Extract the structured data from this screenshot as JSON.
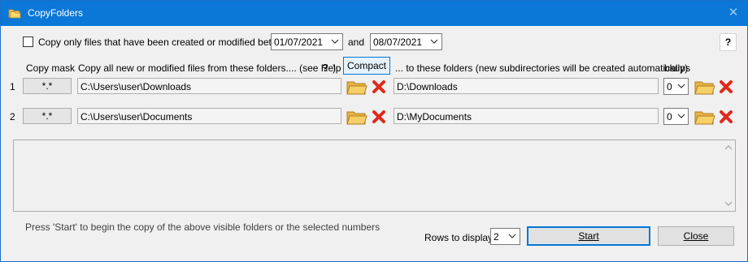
{
  "window": {
    "title": "CopyFolders",
    "close_glyph": "✕",
    "icon": "folder-copy-icon"
  },
  "filter": {
    "checkbox_label": "Copy only files that have been created or modified between",
    "checked": false,
    "date_from": "01/07/2021",
    "and_label": "and",
    "date_to": "08/07/2021"
  },
  "help": {
    "label": "?"
  },
  "headers": {
    "copy_mask": "Copy mask",
    "source": "Copy all new or modified files from these folders.... (see Help in",
    "source_help": "?",
    "source_close": ")",
    "compact_button": "Compact",
    "destination": "... to these folders (new subdirectories will be created automatically)",
    "bkups": "bkups"
  },
  "rows": [
    {
      "number": "1",
      "mask": "*.*",
      "source": "C:\\Users\\user\\Downloads",
      "destination": "D:\\Downloads",
      "bkups": "0"
    },
    {
      "number": "2",
      "mask": "*.*",
      "source": "C:\\Users\\user\\Documents",
      "destination": "D:\\MyDocuments",
      "bkups": "0"
    }
  ],
  "status": {
    "hint": "Press 'Start' to begin the copy of the above visible folders or the selected numbers",
    "rows_label": "Rows to display:",
    "rows_value": "2"
  },
  "buttons": {
    "start": "Start",
    "close": "Close"
  },
  "colors": {
    "titlebar": "#0b78d7",
    "start_border": "#0078d7",
    "delete_red": "#e0281c",
    "folder_yellow": "#f3c65a"
  }
}
